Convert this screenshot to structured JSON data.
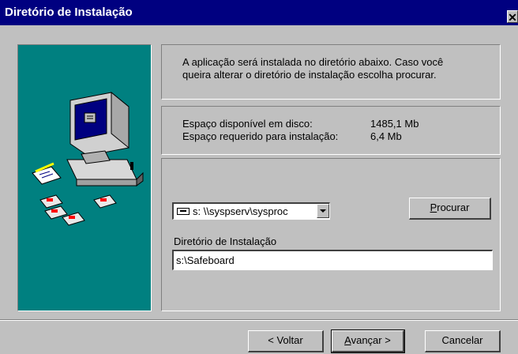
{
  "window": {
    "title": "Diretório de Instalação",
    "close_glyph": "✕"
  },
  "info": {
    "line1": "A aplicação será instalada no diretório abaixo. Caso você",
    "line2": "queira alterar o diretório de instalação escolha procurar."
  },
  "space": {
    "available_label": "Espaço disponível  em disco:",
    "available_value": "1485,1 Mb",
    "required_label": "Espaço requerido para instalação:",
    "required_value": "6,4 Mb"
  },
  "drive_combo": {
    "value": "s: \\\\syspserv\\sysproc",
    "icon": "network-drive-icon"
  },
  "browse_button": {
    "mnemonic": "P",
    "rest": "rocurar"
  },
  "install_dir": {
    "label": "Diretório de Instalação",
    "value": "s:\\Safeboard"
  },
  "footer": {
    "back_label": "< Voltar",
    "next_mnemonic": "A",
    "next_rest": "vançar >",
    "cancel_label": "Cancelar"
  },
  "colors": {
    "titlebar": "#000080",
    "panel": "#008080",
    "face": "#c0c0c0"
  }
}
